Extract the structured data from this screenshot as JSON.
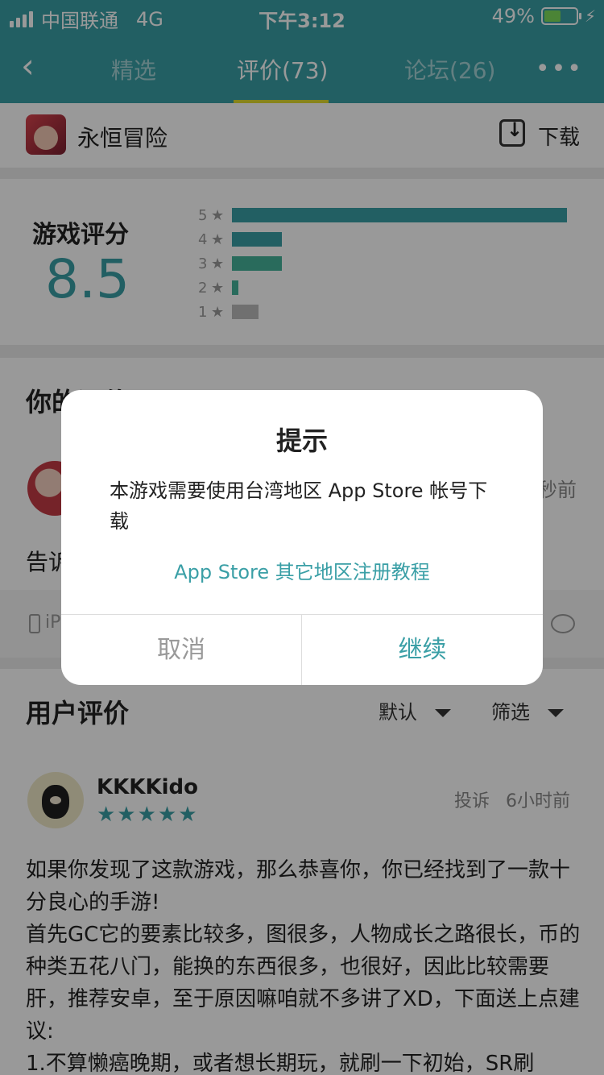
{
  "status_bar": {
    "carrier": "中国联通",
    "network": "4G",
    "time": "下午3:12",
    "battery": "49%"
  },
  "nav": {
    "back_icon": "chevron-left-icon",
    "tabs": [
      {
        "label": "精选"
      },
      {
        "label": "评价(73)"
      },
      {
        "label": "论坛(26)"
      }
    ],
    "more_label": "•••"
  },
  "app": {
    "name": "永恒冒险",
    "download_label": "下载"
  },
  "rating": {
    "title": "游戏评分",
    "score": "8.5",
    "distribution": [
      {
        "stars": "5",
        "fraction": 1.0,
        "color": "#3a9fa6"
      },
      {
        "stars": "4",
        "fraction": 0.15,
        "color": "#3a9fa6"
      },
      {
        "stars": "3",
        "fraction": 0.15,
        "color": "#45b39a"
      },
      {
        "stars": "2",
        "fraction": 0.02,
        "color": "#45b39a"
      },
      {
        "stars": "1",
        "fraction": 0.08,
        "color": "#bbbbbb"
      }
    ]
  },
  "my_review": {
    "title": "你的评价",
    "time": "秒前",
    "text": "告诉",
    "device": "iP"
  },
  "user_reviews": {
    "title": "用户评价",
    "sort_label": "默认",
    "filter_label": "筛选",
    "review": {
      "user": "KKKKido",
      "stars": "★★★★★",
      "report": "投诉",
      "time": "6小时前",
      "body": "如果你发现了这款游戏，那么恭喜你，你已经找到了一款十分良心的手游!\n首先GC它的要素比较多，图很多，人物成长之路很长，币的种类五花八门，能换的东西很多，也很好，因此比较需要肝，推荐安卓，至于原因嘛咱就不多讲了XD，下面送上点建议:\n1.不算懒癌晚期，或者想长期玩，就刷一下初始，SR刷"
    }
  },
  "dialog": {
    "title": "提示",
    "message": "本游戏需要使用台湾地区 App Store 帐号下载",
    "link": "App Store 其它地区注册教程",
    "cancel": "取消",
    "continue": "继续"
  },
  "colors": {
    "accent": "#3a9fa6",
    "tab_indicator": "#e1dd2e"
  }
}
